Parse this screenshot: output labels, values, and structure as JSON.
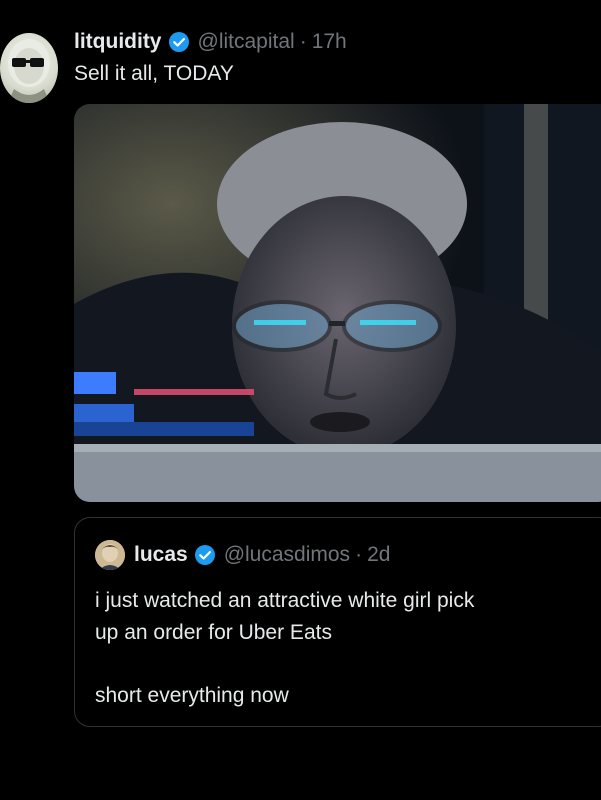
{
  "tweet": {
    "display_name": "litquidity",
    "handle": "@litcapital",
    "separator": "·",
    "time": "17h",
    "text": "Sell it all, TODAY",
    "verified_icon": "verified-badge-icon"
  },
  "quote": {
    "display_name": "lucas",
    "handle": "@lucasdimos",
    "separator": "·",
    "time": "2d",
    "line1": "i just watched an attractive white girl pick",
    "line2": "up an order for Uber Eats",
    "line3": "short everything now",
    "verified_icon": "verified-badge-icon"
  },
  "colors": {
    "background": "#000000",
    "text": "#e7e9ea",
    "muted": "#71767b",
    "verified": "#1d9bf0",
    "border": "#2f3336"
  }
}
